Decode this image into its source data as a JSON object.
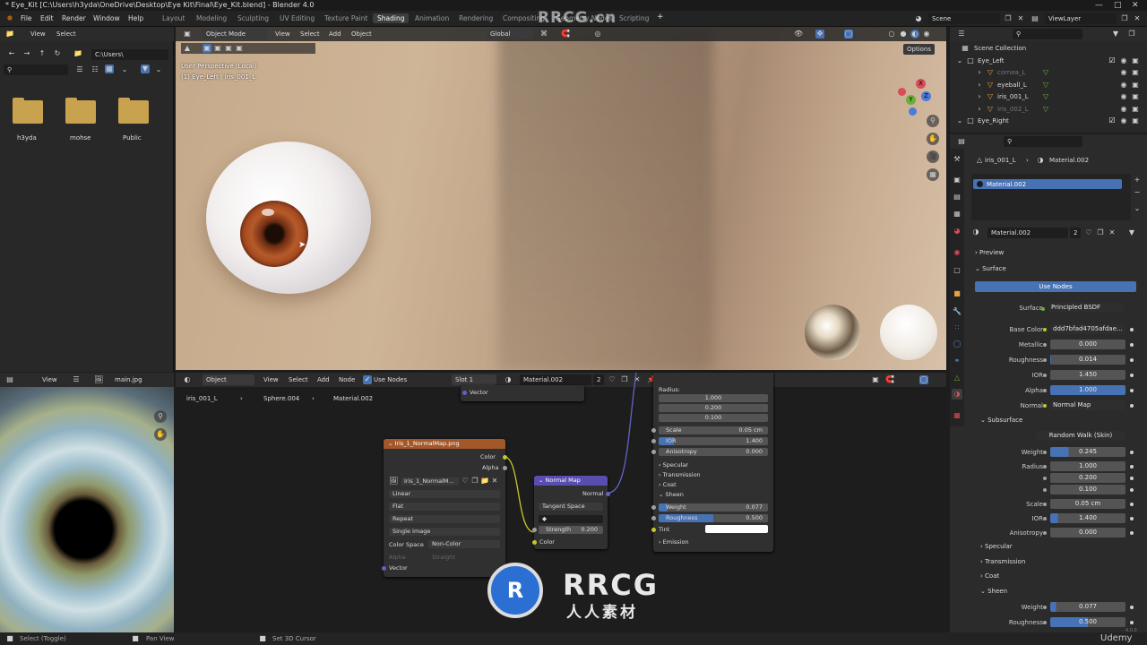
{
  "titlebar": {
    "title": "* Eye_Kit [C:\\Users\\h3yda\\OneDrive\\Desktop\\Eye Kit\\Final\\Eye_Kit.blend] - Blender 4.0"
  },
  "watermark": {
    "text": "RRCG.cn",
    "logo_big": "RRCG",
    "logo_sub": "人人素材"
  },
  "menus": [
    "File",
    "Edit",
    "Render",
    "Window",
    "Help"
  ],
  "workspaces": [
    "Layout",
    "Modeling",
    "Sculpting",
    "UV Editing",
    "Texture Paint",
    "Shading",
    "Animation",
    "Rendering",
    "Compositing",
    "Geometry Nodes",
    "Scripting"
  ],
  "active_workspace": "Shading",
  "scene": {
    "name": "Scene",
    "view_layer": "ViewLayer"
  },
  "file_browser": {
    "menu": [
      "View",
      "Select"
    ],
    "path": "C:\\Users\\",
    "folders": [
      "h3yda",
      "mohse",
      "Public"
    ]
  },
  "viewport": {
    "mode": "Object Mode",
    "menu": [
      "View",
      "Select",
      "Add",
      "Object"
    ],
    "transform": "Global",
    "options_label": "Options",
    "overlay_line1": "User Perspective (Local)",
    "overlay_line2": "(1) Eye_Left | iris_001_L",
    "gizmo_axes": {
      "x": "X",
      "y": "Y",
      "z": "Z"
    }
  },
  "image_editor": {
    "menu": [
      "View"
    ],
    "image_name": "main.jpg"
  },
  "node_editor": {
    "type": "Object",
    "menu": [
      "View",
      "Select",
      "Add",
      "Node"
    ],
    "use_nodes": "Use Nodes",
    "slot": "Slot 1",
    "material": "Material.002",
    "users": "2",
    "breadcrumb": [
      "iris_001_L",
      "Sphere.004",
      "Material.002"
    ],
    "vector_node_label": "Vector",
    "image_node": {
      "title": "Iris_1_NormalMap.png",
      "outputs": [
        "Color",
        "Alpha"
      ],
      "image": "Iris_1_NormalM...",
      "interpolation": "Linear",
      "projection": "Flat",
      "extension": "Repeat",
      "source": "Single Image",
      "color_space_label": "Color Space",
      "color_space": "Non-Color",
      "alpha_label": "Alpha",
      "alpha_mode": "Straight",
      "input": "Vector"
    },
    "normal_node": {
      "title": "Normal Map",
      "output": "Normal",
      "space": "Tangent Space",
      "uv": "",
      "strength_label": "Strength",
      "strength": "0.200",
      "input": "Color"
    },
    "bsdf_partial": {
      "radius_label": "Radius:",
      "radius": [
        "1.000",
        "0.200",
        "0.100"
      ],
      "scale_label": "Scale",
      "scale": "0.05 cm",
      "ior_label": "IOR",
      "ior": "1.400",
      "aniso_label": "Anisotropy",
      "aniso": "0.000",
      "sections": [
        "Specular",
        "Transmission",
        "Coat",
        "Sheen"
      ],
      "weight_label": "Weight",
      "weight": "0.077",
      "rough_label": "Roughness",
      "rough": "0.500",
      "tint_label": "Tint",
      "emission": "Emission"
    }
  },
  "outliner": {
    "root": "Scene Collection",
    "items": [
      {
        "name": "Eye_Left",
        "indent": 0,
        "kind": "collection"
      },
      {
        "name": "cornea_L",
        "indent": 1,
        "kind": "mesh",
        "dim": true
      },
      {
        "name": "eyeball_L",
        "indent": 1,
        "kind": "mesh",
        "dim": false
      },
      {
        "name": "iris_001_L",
        "indent": 1,
        "kind": "mesh",
        "dim": false
      },
      {
        "name": "iris_002_L",
        "indent": 1,
        "kind": "mesh",
        "dim": true
      },
      {
        "name": "Eye_Right",
        "indent": 0,
        "kind": "collection"
      }
    ]
  },
  "properties": {
    "object": "iris_001_L",
    "material_context": "Material.002",
    "slot_name": "Material.002",
    "material_name": "Material.002",
    "users": "2",
    "preview": "Preview",
    "surface_section": "Surface",
    "use_nodes": "Use Nodes",
    "surface_label": "Surface",
    "surface_value": "Principled BSDF",
    "fields": [
      {
        "label": "Base Color",
        "value": "ddd7bfad4705afdae...",
        "kind": "link"
      },
      {
        "label": "Metallic",
        "value": "0.000",
        "fill": 0
      },
      {
        "label": "Roughness",
        "value": "0.014",
        "fill": 0.014
      },
      {
        "label": "IOR",
        "value": "1.450",
        "fill": 0
      },
      {
        "label": "Alpha",
        "value": "1.000",
        "fill": 1
      },
      {
        "label": "Normal",
        "value": "Normal Map",
        "kind": "link"
      }
    ],
    "subsurface_section": "Subsurface",
    "subsurface_method": "Random Walk (Skin)",
    "subsurface_fields": [
      {
        "label": "Weight",
        "value": "0.245",
        "fill": 0.245
      },
      {
        "label": "Radius",
        "value": "1.000",
        "fill": 0
      },
      {
        "label": "",
        "value": "0.200",
        "fill": 0
      },
      {
        "label": "",
        "value": "0.100",
        "fill": 0
      },
      {
        "label": "Scale",
        "value": "0.05 cm",
        "fill": 0
      },
      {
        "label": "IOR",
        "value": "1.400",
        "fill": 0.1
      },
      {
        "label": "Anisotropy",
        "value": "0.000",
        "fill": 0
      }
    ],
    "collapsed_sections": [
      "Specular",
      "Transmission",
      "Coat"
    ],
    "sheen_section": "Sheen",
    "sheen_fields": [
      {
        "label": "Weight",
        "value": "0.077",
        "fill": 0.077
      },
      {
        "label": "Roughness",
        "value": "0.500",
        "fill": 0.5
      }
    ]
  },
  "status": {
    "left": "Select (Toggle)",
    "middle": "Pan View",
    "right": "Set 3D Cursor",
    "version": "4.0.0",
    "brand": "Udemy"
  },
  "colors": {
    "accent": "#4772b3",
    "image_node_header": "#a3582a",
    "vector_node_header": "#5a4db0",
    "socket_yellow": "#c7c729",
    "socket_purple": "#6363c7"
  }
}
